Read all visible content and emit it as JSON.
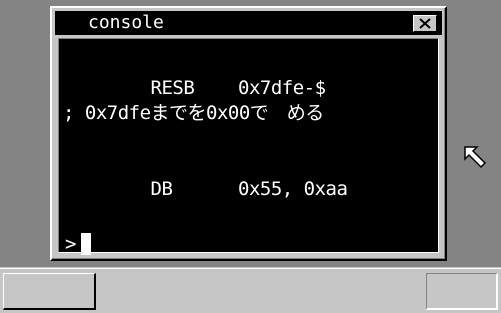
{
  "window": {
    "title": "console",
    "close_icon": "close-icon"
  },
  "console": {
    "lines": [
      "        RESB    0x7dfe-$",
      "; 0x7dfeまでを0x00で　める",
      "",
      "        DB      0x55, 0xaa"
    ],
    "prompt": ">"
  },
  "taskbar": {
    "start_icon": "start-button",
    "tray_icon": "tray-area"
  },
  "colors": {
    "desktop": "#848484",
    "face": "#c6c6c6",
    "console_bg": "#000000",
    "console_fg": "#ffffff"
  }
}
